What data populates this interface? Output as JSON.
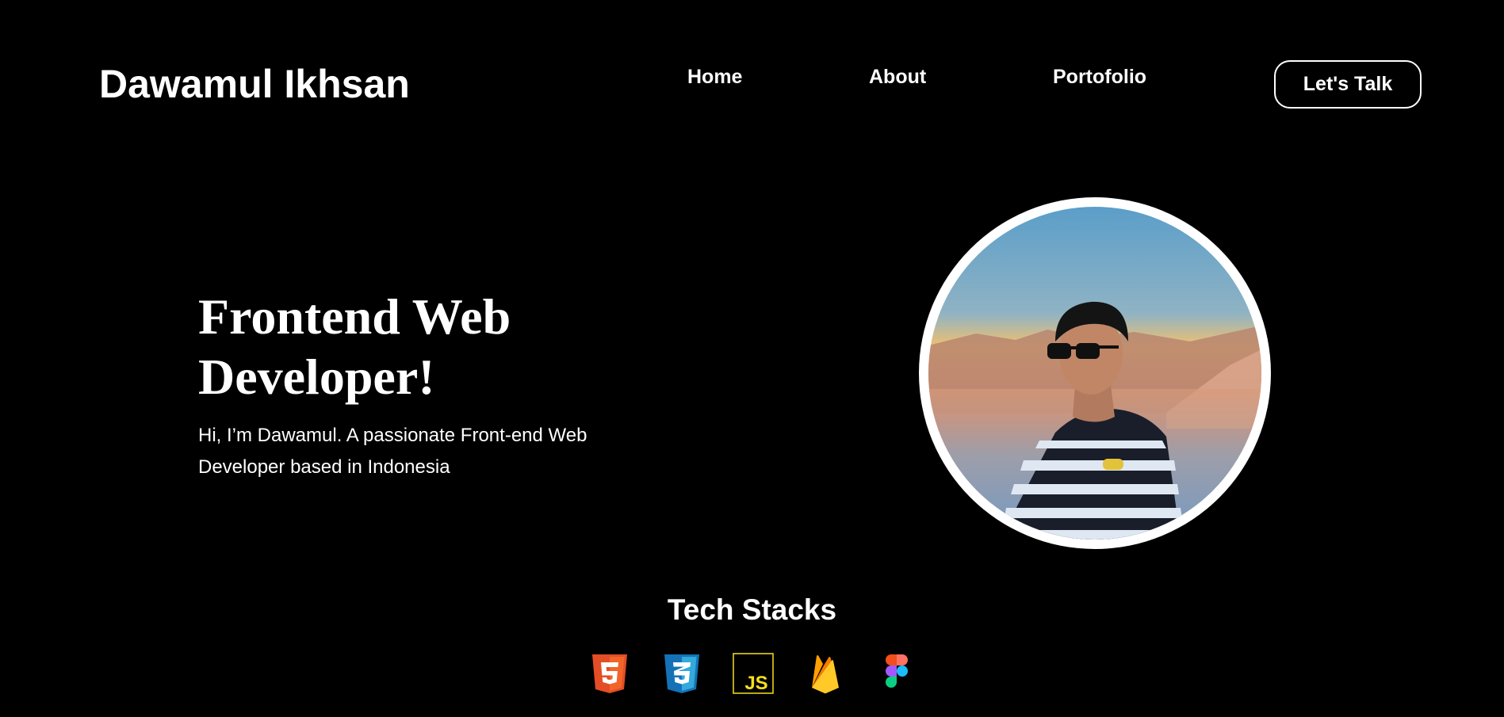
{
  "header": {
    "brand": "Dawamul Ikhsan",
    "nav": {
      "home": "Home",
      "about": "About",
      "portfolio": "Portofolio"
    },
    "cta_label": "Let's Talk"
  },
  "hero": {
    "title_line1": "Frontend Web",
    "title_line2": "Developer!",
    "description_line1": "Hi, I’m Dawamul. A passionate Front-end Web",
    "description_line2": "Developer based in Indonesia",
    "photo_icon": "profile-photo"
  },
  "tech_stacks": {
    "title": "Tech Stacks",
    "icons": [
      "html5-icon",
      "css3-icon",
      "javascript-icon",
      "firebase-icon",
      "figma-icon"
    ]
  },
  "colors": {
    "background": "#000000",
    "text": "#ffffff",
    "html5": "#E44D26",
    "css3": "#1572B6",
    "javascript": "#F7DF1E",
    "firebase": "#FFCA28"
  }
}
